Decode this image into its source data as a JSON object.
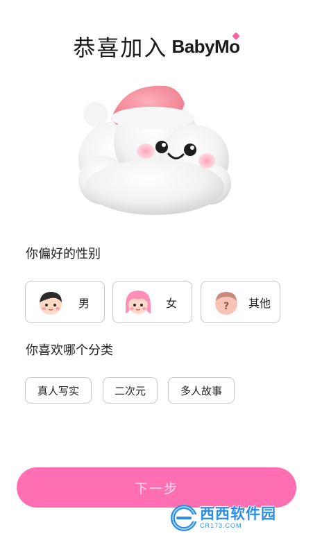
{
  "header": {
    "title": "恭喜加入",
    "brand": "BabyMo"
  },
  "gender": {
    "label": "你偏好的性别",
    "options": [
      {
        "label": "男",
        "icon": "boy-avatar-icon"
      },
      {
        "label": "女",
        "icon": "girl-avatar-icon"
      },
      {
        "label": "其他",
        "icon": "unknown-avatar-icon"
      }
    ]
  },
  "category": {
    "label": "你喜欢哪个分类",
    "options": [
      "真人写实",
      "二次元",
      "多人故事"
    ]
  },
  "actions": {
    "next_label": "下一步"
  },
  "watermark": {
    "text": "西西软件园",
    "sub": "CR173.COM"
  },
  "colors": {
    "accent": "#ff6fb1",
    "border": "#c9c9c9",
    "watermark": "#2a8ee8"
  }
}
